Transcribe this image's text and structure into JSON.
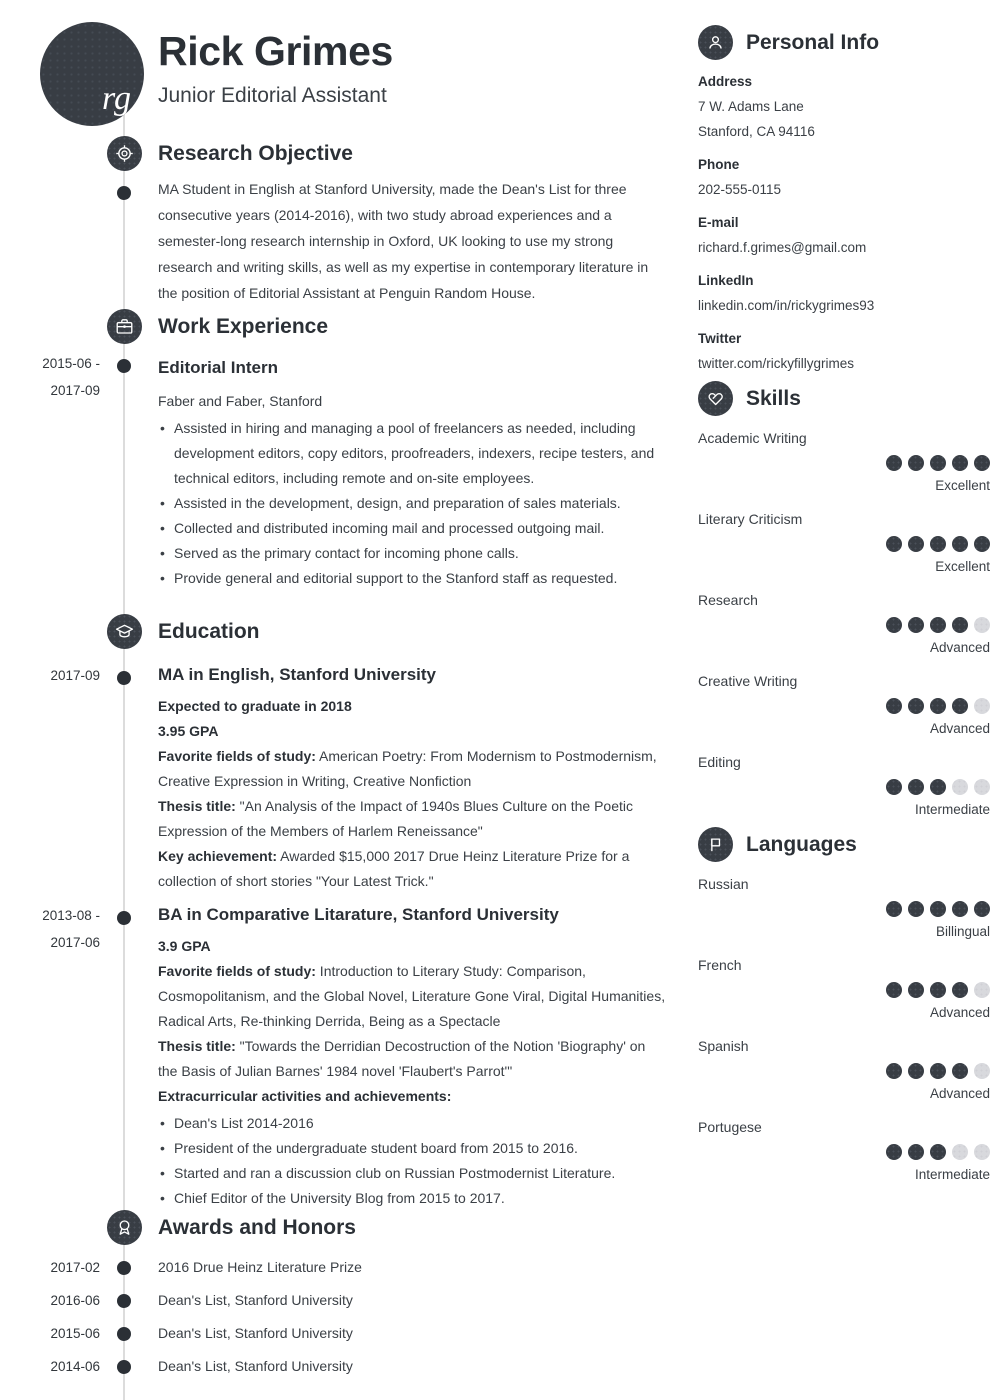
{
  "header": {
    "avatar_initials": "rg",
    "name": "Rick Grimes",
    "job_title": "Junior Editorial Assistant"
  },
  "sections": {
    "research_objective": {
      "title": "Research Objective",
      "icon": "target-icon",
      "text": "MA Student in English at Stanford University, made the Dean's List for three consecutive years (2014-2016), with two study abroad experiences and a semester-long research internship in Oxford, UK looking to use my strong research and writing skills, as well as my expertise in contemporary literature in the position of Editorial Assistant at Penguin Random House."
    },
    "work_experience": {
      "title": "Work Experience",
      "icon": "briefcase-icon",
      "entries": [
        {
          "date_start": "2015-06 -",
          "date_end": "2017-09",
          "title": "Editorial Intern",
          "employer": "Faber and Faber, Stanford",
          "bullets": [
            "Assisted in hiring and managing a pool of freelancers as needed, including development editors, copy editors, proofreaders, indexers, recipe testers, and technical editors, including remote and on-site employees.",
            "Assisted in the development, design, and preparation of sales materials.",
            "Collected and distributed incoming mail and processed outgoing mail.",
            "Served as the primary contact for incoming phone calls.",
            "Provide general and editorial support to the Stanford staff as requested."
          ]
        }
      ]
    },
    "education": {
      "title": "Education",
      "icon": "graduation-cap-icon",
      "entries": [
        {
          "date_start": "2017-09",
          "date_end": "",
          "title": "MA in English, Stanford University",
          "lines": [
            {
              "label": "Expected to graduate in 2018",
              "value": ""
            },
            {
              "label": "3.95 GPA",
              "value": ""
            },
            {
              "label": "Favorite fields of study:",
              "value": " American Poetry: From Modernism to Postmodernism, Creative Expression in Writing, Creative Nonfiction"
            },
            {
              "label": "Thesis title:",
              "value": " \"An Analysis of the Impact of 1940s Blues Culture on the Poetic Expression of the Members of Harlem Reneissance\""
            },
            {
              "label": "Key achievement:",
              "value": " Awarded $15,000 2017 Drue Heinz Literature Prize for a collection of short stories \"Your Latest Trick.\""
            }
          ],
          "bullets": []
        },
        {
          "date_start": "2013-08 -",
          "date_end": "2017-06",
          "title": "BA in Comparative Litarature, Stanford University",
          "lines": [
            {
              "label": "3.9 GPA",
              "value": ""
            },
            {
              "label": "Favorite fields of study:",
              "value": " Introduction to Literary Study: Comparison, Cosmopolitanism, and the Global Novel, Literature Gone Viral, Digital Humanities, Radical Arts, Re-thinking Derrida, Being as a Spectacle"
            },
            {
              "label": "Thesis title:",
              "value": " \"Towards the Derridian Decostruction of the Notion 'Biography' on the Basis of Julian Barnes' 1984 novel 'Flaubert's Parrot'\""
            },
            {
              "label": "Extracurricular activities and achievements:",
              "value": ""
            }
          ],
          "bullets": [
            "Dean's List 2014-2016",
            "President of the undergraduate student board from 2015 to 2016.",
            "Started and ran a discussion club on Russian Postmodernist Literature.",
            "Chief Editor of the University Blog from 2015 to 2017."
          ]
        }
      ]
    },
    "awards": {
      "title": "Awards and Honors",
      "icon": "award-ribbon-icon",
      "entries": [
        {
          "date": "2017-02",
          "text": "2016 Drue Heinz Literature Prize"
        },
        {
          "date": "2016-06",
          "text": "Dean's List, Stanford University"
        },
        {
          "date": "2015-06",
          "text": "Dean's List, Stanford University"
        },
        {
          "date": "2014-06",
          "text": "Dean's List, Stanford University"
        }
      ]
    }
  },
  "sidebar": {
    "personal_info": {
      "title": "Personal Info",
      "icon": "person-icon",
      "fields": [
        {
          "label": "Address",
          "value": "7 W. Adams Lane",
          "value2": "Stanford, CA 94116"
        },
        {
          "label": "Phone",
          "value": "202-555-0115",
          "value2": ""
        },
        {
          "label": "E-mail",
          "value": "richard.f.grimes@gmail.com",
          "value2": ""
        },
        {
          "label": "LinkedIn",
          "value": "linkedin.com/in/rickygrimes93",
          "value2": ""
        },
        {
          "label": "Twitter",
          "value": "twitter.com/rickyfillygrimes",
          "value2": ""
        }
      ]
    },
    "skills": {
      "title": "Skills",
      "icon": "skills-heart-icon",
      "max": 5,
      "items": [
        {
          "name": "Academic Writing",
          "rating": 5,
          "level": "Excellent"
        },
        {
          "name": "Literary Criticism",
          "rating": 5,
          "level": "Excellent"
        },
        {
          "name": "Research",
          "rating": 4,
          "level": "Advanced"
        },
        {
          "name": "Creative Writing",
          "rating": 4,
          "level": "Advanced"
        },
        {
          "name": "Editing",
          "rating": 3,
          "level": "Intermediate"
        }
      ]
    },
    "languages": {
      "title": "Languages",
      "icon": "flag-icon",
      "max": 5,
      "items": [
        {
          "name": "Russian",
          "rating": 5,
          "level": "Billingual"
        },
        {
          "name": "French",
          "rating": 4,
          "level": "Advanced"
        },
        {
          "name": "Spanish",
          "rating": 4,
          "level": "Advanced"
        },
        {
          "name": "Portugese",
          "rating": 3,
          "level": "Intermediate"
        }
      ]
    }
  },
  "colors": {
    "dark": "#383d44",
    "text": "#3b4046",
    "heading": "#2b3036",
    "rail": "#dcdcdc",
    "dot_off": "#d8d9dd"
  }
}
